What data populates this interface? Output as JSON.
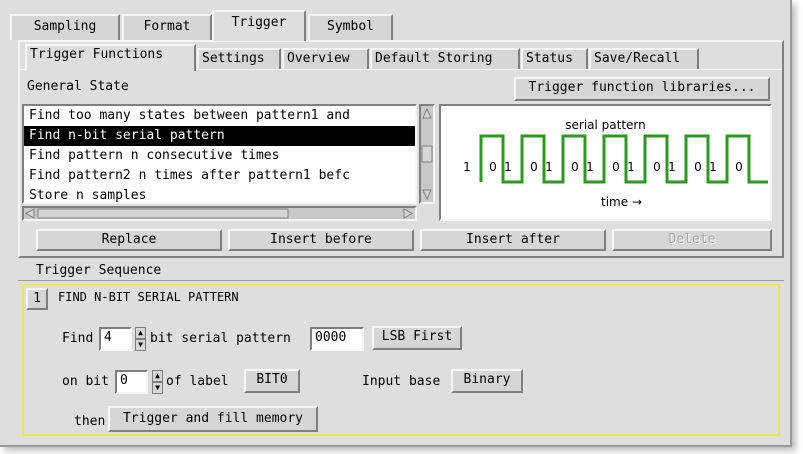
{
  "tabs": [
    "Sampling",
    "Format",
    "Trigger",
    "Symbol"
  ],
  "subtabs": [
    "Trigger Functions",
    "Settings",
    "Overview",
    "Default Storing",
    "Status",
    "Save/Recall"
  ],
  "general_state": {
    "label": "General State",
    "libraries_button": "Trigger function libraries...",
    "items": [
      "Find too many states between pattern1 and",
      "Find n-bit serial pattern",
      "Find pattern n consecutive times",
      "Find pattern2 n times after pattern1 befc",
      "Store n samples"
    ]
  },
  "preview": {
    "title": "serial pattern",
    "bits": [
      "1",
      "0",
      "1",
      "0",
      "1",
      "0",
      "1",
      "0",
      "1",
      "0",
      "1",
      "0",
      "1",
      "0"
    ],
    "time_label": "time",
    "time_arrow": "→"
  },
  "actions": {
    "replace": "Replace",
    "insert_before": "Insert before",
    "insert_after": "Insert after",
    "delete": "Delete"
  },
  "sequence": {
    "label": "Trigger Sequence",
    "step_number": "1",
    "step_title": "FIND N-BIT SERIAL PATTERN",
    "find_label": "Find",
    "bit_count": "4",
    "bit_pattern_label": "bit serial pattern",
    "pattern_value": "0000",
    "order_button": "LSB First",
    "on_bit_label": "on bit",
    "on_bit_value": "0",
    "of_label_label": "of label",
    "label_button": "BIT0",
    "input_base_label": "Input base",
    "input_base_button": "Binary",
    "then_label": "then",
    "then_button": "Trigger and fill memory"
  },
  "colors": {
    "waveform": "#2a9b1e",
    "highlight_border": "#ece64e",
    "selection": "#000000"
  }
}
